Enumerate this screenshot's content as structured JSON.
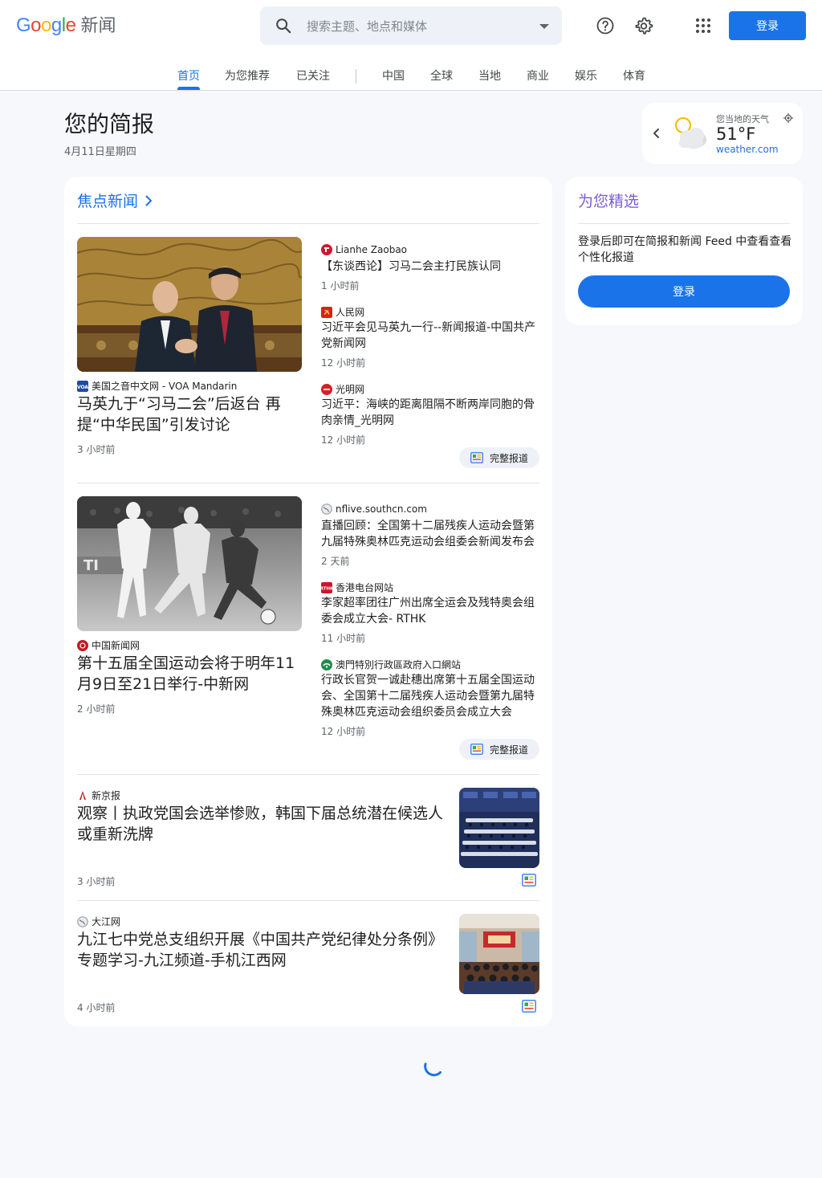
{
  "header": {
    "logo_news": "新闻",
    "search_placeholder": "搜索主题、地点和媒体",
    "login_label": "登录"
  },
  "tabs": [
    {
      "label": "首页",
      "active": true
    },
    {
      "label": "为您推荐"
    },
    {
      "label": "已关注"
    },
    {
      "label": "中国"
    },
    {
      "label": "全球"
    },
    {
      "label": "当地"
    },
    {
      "label": "商业"
    },
    {
      "label": "娱乐"
    },
    {
      "label": "体育"
    }
  ],
  "briefing": {
    "title": "您的简报",
    "date": "4月11日星期四"
  },
  "weather": {
    "label": "您当地的天气",
    "temp": "51°F",
    "source": "weather.com"
  },
  "top_stories": {
    "title": "焦点新闻",
    "full_coverage_label": "完整报道",
    "clusters": [
      {
        "hero": {
          "source": "美国之音中文网 - VOA Mandarin",
          "title": "马英九于“习马二会”后返台 再提“中华民国”引发讨论",
          "time": "3 小时前"
        },
        "side": [
          {
            "source": "Lianhe Zaobao",
            "title": "【东谈西论】习马二会主打民族认同",
            "time": "1 小时前"
          },
          {
            "source": "人民网",
            "title": "习近平会见马英九一行--新闻报道-中国共产党新闻网",
            "time": "12 小时前"
          },
          {
            "source": "光明网",
            "title": "习近平：海峡的距离阻隔不断两岸同胞的骨肉亲情_光明网",
            "time": "12 小时前"
          }
        ]
      },
      {
        "hero": {
          "source": "中国新闻网",
          "title": "第十五届全国运动会将于明年11月9日至21日举行-中新网",
          "time": "2 小时前"
        },
        "side": [
          {
            "source": "nflive.southcn.com",
            "title": "直播回顾：全国第十二届残疾人运动会暨第九届特殊奥林匹克运动会组委会新闻发布会",
            "time": "2 天前"
          },
          {
            "source": "香港电台网站",
            "title": "李家超率团往广州出席全运会及残特奥会组委会成立大会- RTHK",
            "time": "11 小时前"
          },
          {
            "source": "澳門特別行政區政府入口網站",
            "title": "行政长官贺一诚赴穗出席第十五届全国运动会、全国第十二届残疾人运动会暨第九届特殊奥林匹克运动会组织委员会成立大会",
            "time": "12 小时前"
          }
        ]
      }
    ],
    "rows": [
      {
        "source": "新京报",
        "title": "观察丨执政党国会选举惨败，韩国下届总统潜在候选人或重新洗牌",
        "time": "3 小时前"
      },
      {
        "source": "大江网",
        "title": "九江七中党总支组织开展《中国共产党纪律处分条例》专题学习-九江频道-手机江西网",
        "time": "4 小时前"
      }
    ]
  },
  "picks": {
    "title": "为您精选",
    "text": "登录后即可在简报和新闻 Feed 中查看查看个性化报道",
    "button": "登录"
  },
  "colors": {
    "accent": "#1a73e8",
    "picks_title": "#7b5cd6",
    "background": "#f6f8fc"
  }
}
